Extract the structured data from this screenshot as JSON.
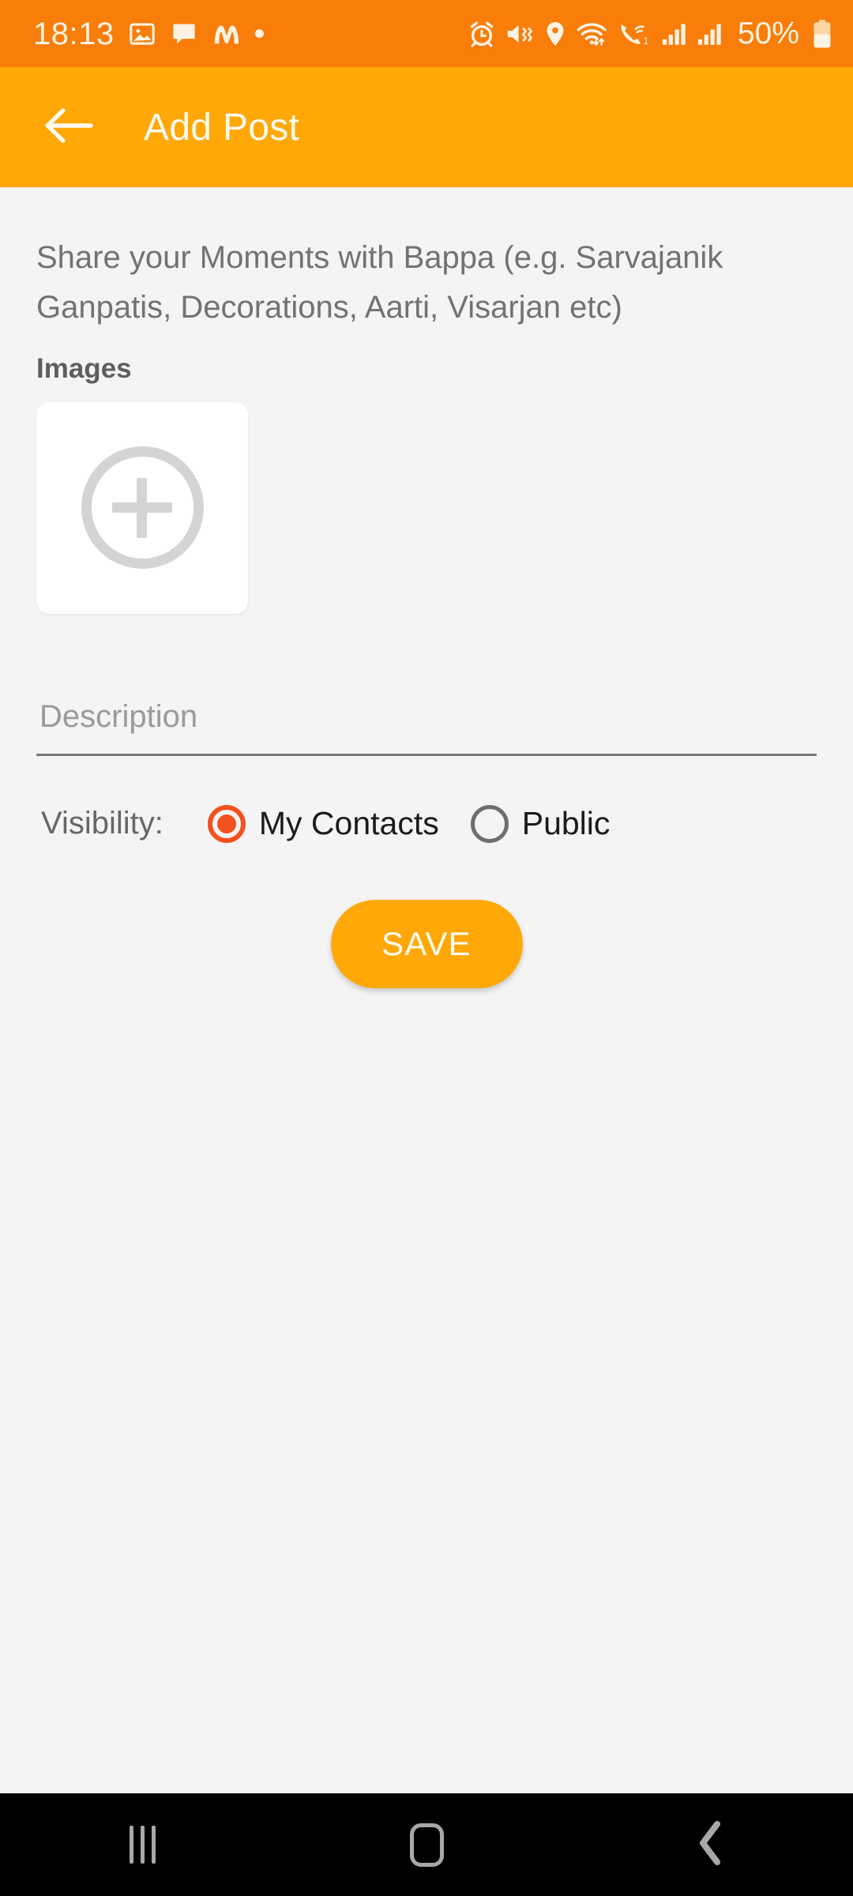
{
  "status_bar": {
    "time": "18:13",
    "battery_percent": "50%",
    "left_icons": [
      "photo-icon",
      "chat-bubble-icon",
      "m-app-icon",
      "dot-indicator-icon"
    ],
    "right_icons": [
      "alarm-icon",
      "mute-vibrate-icon",
      "location-pin-icon",
      "wifi-data-icon",
      "wifi-calling-icon",
      "signal-bars-sim1-icon",
      "signal-bars-sim2-icon",
      "battery-icon"
    ],
    "background_color": "#f97d09",
    "foreground_color": "#fdf3e4"
  },
  "app_bar": {
    "title": "Add Post",
    "back_icon": "arrow-left-icon",
    "background_color": "#ffa808",
    "title_color": "#fffbef"
  },
  "main": {
    "intro_text": "Share your Moments with Bappa (e.g. Sarvajanik Ganpatis, Decorations, Aarti, Visarjan etc)",
    "images_label": "Images",
    "add_image_icon": "plus-circle-icon",
    "description": {
      "value": "",
      "placeholder": "Description"
    },
    "visibility": {
      "label": "Visibility:",
      "selected": "My Contacts",
      "options": [
        {
          "label": "My Contacts",
          "checked": true
        },
        {
          "label": "Public",
          "checked": false
        }
      ],
      "accent_color": "#f4511e"
    },
    "save_button": {
      "label": "SAVE",
      "background_color": "#ffa808",
      "text_color": "#fffbef"
    },
    "background_color": "#f4f4f4"
  },
  "nav_bar": {
    "background_color": "#000000",
    "icon_color": "#a8a8a8",
    "buttons": [
      {
        "name": "recents",
        "icon": "recents-icon"
      },
      {
        "name": "home",
        "icon": "home-icon"
      },
      {
        "name": "back",
        "icon": "chevron-left-icon"
      }
    ]
  }
}
